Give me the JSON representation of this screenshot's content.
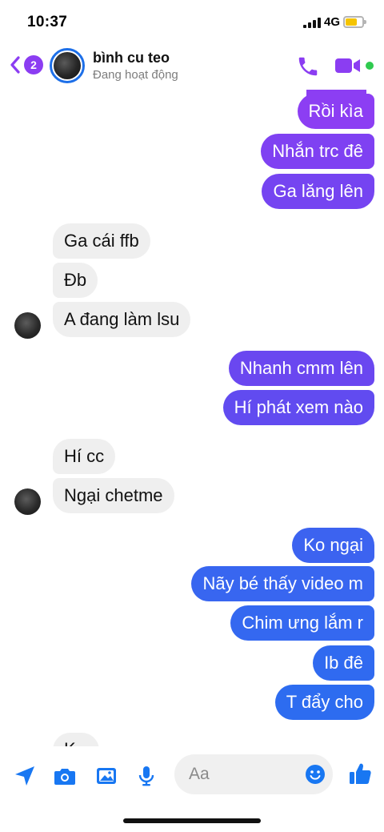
{
  "status_bar": {
    "time": "10:37",
    "network": "4G"
  },
  "header": {
    "back_badge": "2",
    "contact_name": "bình cu teo",
    "contact_status": "Đang hoạt động"
  },
  "messages": {
    "sent_group_1": [
      "Rồi kìa",
      "Nhắn trc đê",
      "Ga lăng lên"
    ],
    "received_group_1": [
      "Ga cái ffb",
      "Đb",
      "A đang làm lsu"
    ],
    "sent_group_2": [
      "Nhanh cmm lên",
      "Hí phát xem nào"
    ],
    "received_group_2": [
      "Hí cc",
      "Ngại chetme"
    ],
    "sent_group_3": [
      "Ko ngại",
      "Nãy bé thấy video m",
      "Chim ưng lắm r",
      "Ib đê",
      "T đẩy cho"
    ],
    "received_partial": "K"
  },
  "composer": {
    "placeholder": "Aa"
  },
  "colors": {
    "accent": "#8b3df2",
    "sent_purple": "#8c3ef3",
    "sent_indigo": "#6a47f0",
    "sent_blue": "#2f6af0",
    "received_bg": "#efefef",
    "icon_blue": "#1877f2",
    "active_green": "#2fca4f"
  }
}
